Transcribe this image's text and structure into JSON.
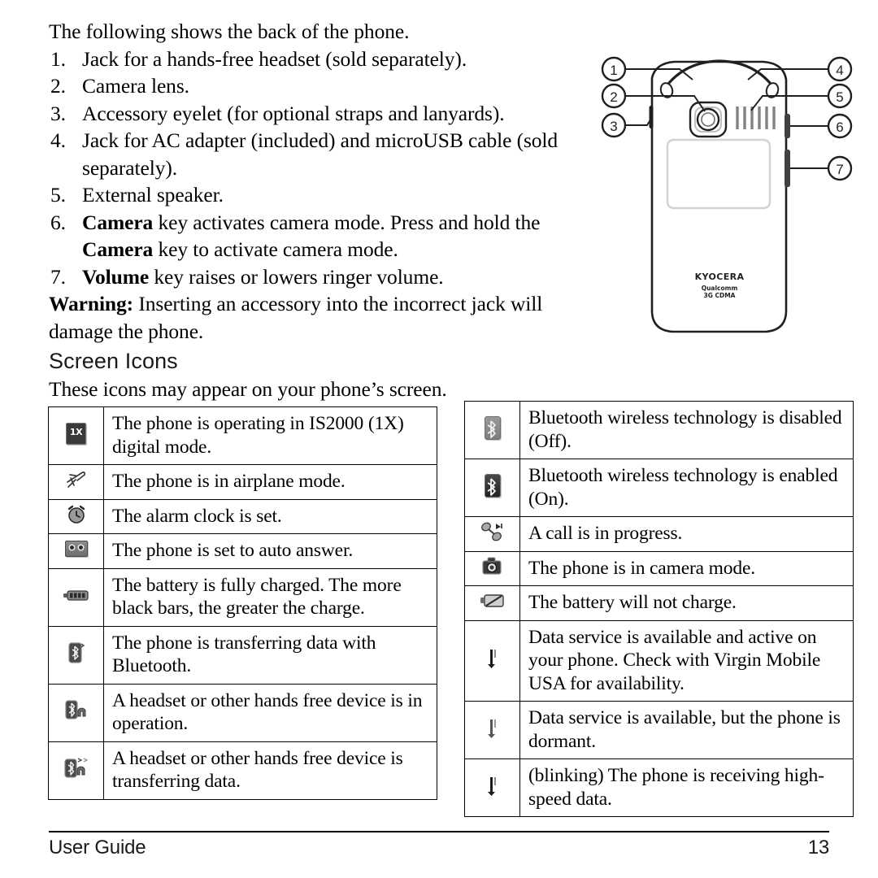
{
  "document": {
    "intro_text": "The following shows the back of the phone.",
    "parts_list": [
      {
        "num": "1.",
        "text": "Jack for a hands-free headset (sold separately)."
      },
      {
        "num": "2.",
        "text": "Camera lens."
      },
      {
        "num": "3.",
        "text": "Accessory eyelet (for optional straps and lanyards)."
      },
      {
        "num": "4.",
        "text": "Jack for AC adapter (included) and microUSB cable (sold separately)."
      },
      {
        "num": "5.",
        "text": "External speaker."
      },
      {
        "num": "6.",
        "bold_lead": "Camera",
        "text": "Camera key activates camera mode. Press and hold the Camera key to activate camera mode."
      },
      {
        "num": "7.",
        "bold_lead": "Volume",
        "text": "Volume key raises or lowers ringer volume."
      }
    ],
    "warning_label": "Warning:",
    "warning_text": "Inserting an accessory into the incorrect jack will damage the phone.",
    "section_heading": "Screen Icons",
    "section_subtitle": "These icons may appear on your phone’s screen."
  },
  "diagram": {
    "callouts": [
      "1",
      "2",
      "3",
      "4",
      "5",
      "6",
      "7"
    ],
    "brand": "KYOCERA",
    "chipset": "Qualcomm",
    "network": "3G CDMA"
  },
  "icon_table_left": [
    {
      "icon": "one-x-icon",
      "text": "The phone is operating in IS2000 (1X) digital mode."
    },
    {
      "icon": "airplane-mode-icon",
      "text": "The phone is in airplane mode."
    },
    {
      "icon": "alarm-clock-icon",
      "text": "The alarm clock is set."
    },
    {
      "icon": "auto-answer-icon",
      "text": "The phone is set to auto answer."
    },
    {
      "icon": "battery-full-icon",
      "text": "The battery is fully charged. The more black bars, the greater the charge."
    },
    {
      "icon": "bluetooth-transfer-icon",
      "text": "The phone is transferring data with Bluetooth."
    },
    {
      "icon": "headset-active-icon",
      "text": "A headset or other hands free device is in operation."
    },
    {
      "icon": "headset-transfer-icon",
      "text": "A headset or other hands free device is transferring data."
    }
  ],
  "icon_table_right": [
    {
      "icon": "bluetooth-off-icon",
      "text": "Bluetooth wireless technology is disabled (Off)."
    },
    {
      "icon": "bluetooth-on-icon",
      "text": "Bluetooth wireless technology is enabled (On)."
    },
    {
      "icon": "call-in-progress-icon",
      "text": "A call is in progress."
    },
    {
      "icon": "camera-mode-icon",
      "text": "The phone is in camera mode."
    },
    {
      "icon": "battery-no-charge-icon",
      "text": "The battery will not charge."
    },
    {
      "icon": "data-active-icon",
      "text": "Data service is available and active on your phone. Check with Virgin Mobile USA for availability."
    },
    {
      "icon": "data-dormant-icon",
      "text": "Data service is available, but the phone is dormant."
    },
    {
      "icon": "data-highspeed-icon",
      "text": "(blinking) The phone is receiving high-speed data."
    }
  ],
  "footer": {
    "left": "User Guide",
    "page_number": "13"
  },
  "colors": {
    "text": "#000000",
    "rule": "#000000",
    "icon_dark": "#2b2b2b",
    "icon_gray": "#8d8d8d"
  }
}
